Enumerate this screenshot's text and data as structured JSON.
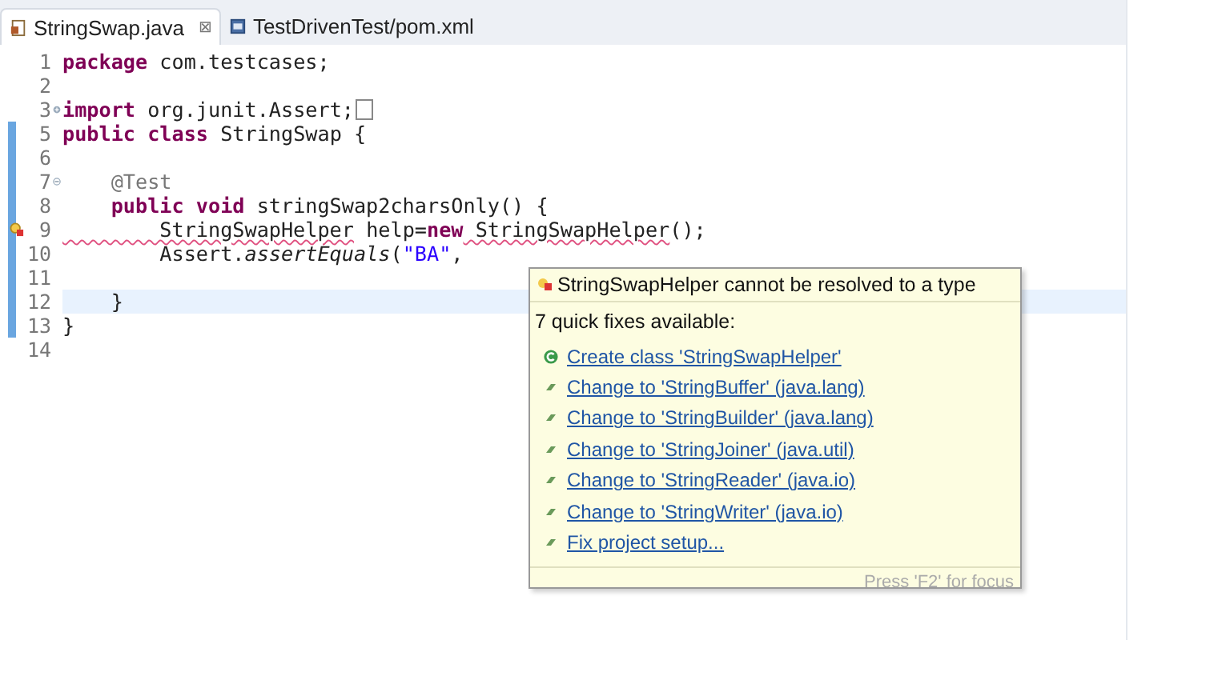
{
  "tabs": [
    {
      "label": "StringSwap.java",
      "selected": true,
      "close": "⊠",
      "kind": "java"
    },
    {
      "label": "TestDrivenTest/pom.xml",
      "selected": false,
      "kind": "xml"
    }
  ],
  "editor": {
    "lines": [
      {
        "number": "1",
        "in_scope": false,
        "current": false,
        "error": false,
        "tokens": [
          {
            "kind": "kw",
            "text": "package"
          },
          {
            "kind": "plain",
            "text": " com.testcases;"
          }
        ]
      },
      {
        "number": "2",
        "in_scope": false,
        "current": false,
        "error": false
      },
      {
        "number": "3",
        "in_scope": false,
        "current": false,
        "error": false,
        "collapsed": true,
        "tokens": [
          {
            "kind": "kw",
            "text": "import"
          },
          {
            "kind": "plain",
            "text": " org.junit.Assert;"
          }
        ]
      },
      {
        "number": "5",
        "in_scope": true,
        "current": false,
        "error": false,
        "tokens": [
          {
            "kind": "kw",
            "text": "public class"
          },
          {
            "kind": "plain",
            "text": " StringSwap {"
          }
        ]
      },
      {
        "number": "6",
        "in_scope": true,
        "current": false,
        "error": false
      },
      {
        "number": "7",
        "in_scope": true,
        "current": false,
        "error": false,
        "collapsed": false,
        "tokens": [
          {
            "kind": "ann",
            "text": "    @Test"
          }
        ]
      },
      {
        "number": "8",
        "in_scope": true,
        "current": false,
        "error": false,
        "tokens": [
          {
            "kind": "kw",
            "text": "    public void"
          },
          {
            "kind": "plain",
            "text": " stringSwap2charsOnly() {"
          }
        ]
      },
      {
        "number": "9",
        "in_scope": true,
        "current": false,
        "error": true,
        "tokens": [
          {
            "kind": "err",
            "text": "        StringSwapHelper"
          },
          {
            "kind": "plain",
            "text": " help="
          },
          {
            "kind": "kw",
            "text": "new"
          },
          {
            "kind": "err",
            "text": " StringSwapHelper"
          },
          {
            "kind": "plain",
            "text": "();"
          }
        ]
      },
      {
        "number": "10",
        "in_scope": true,
        "current": false,
        "error": false,
        "tokens": [
          {
            "kind": "plain",
            "text": "        Assert."
          },
          {
            "kind": "italic",
            "text": "assertEquals"
          },
          {
            "kind": "plain",
            "text": "("
          },
          {
            "kind": "str",
            "text": "\"BA\""
          },
          {
            "kind": "plain",
            "text": ","
          }
        ]
      },
      {
        "number": "11",
        "in_scope": true,
        "current": false,
        "error": false
      },
      {
        "number": "12",
        "in_scope": true,
        "current": true,
        "error": false,
        "tokens": [
          {
            "kind": "plain",
            "text": "    }"
          }
        ]
      },
      {
        "number": "13",
        "in_scope": true,
        "current": false,
        "error": false,
        "tokens": [
          {
            "kind": "plain",
            "text": "}"
          }
        ]
      },
      {
        "number": "14",
        "in_scope": false,
        "current": false,
        "error": false
      }
    ]
  },
  "popup": {
    "title": "StringSwapHelper cannot be resolved to a type",
    "subtitle": "7 quick fixes available:",
    "fixes": [
      {
        "label": "Create class 'StringSwapHelper'",
        "kind": "create"
      },
      {
        "label": "Change to 'StringBuffer' (java.lang)",
        "kind": "change"
      },
      {
        "label": "Change to 'StringBuilder' (java.lang)",
        "kind": "change"
      },
      {
        "label": "Change to 'StringJoiner' (java.util)",
        "kind": "change"
      },
      {
        "label": "Change to 'StringReader' (java.io)",
        "kind": "change"
      },
      {
        "label": "Change to 'StringWriter' (java.io)",
        "kind": "change"
      },
      {
        "label": "Fix project setup...",
        "kind": "change"
      }
    ],
    "footer": "Press 'F2' for focus"
  }
}
